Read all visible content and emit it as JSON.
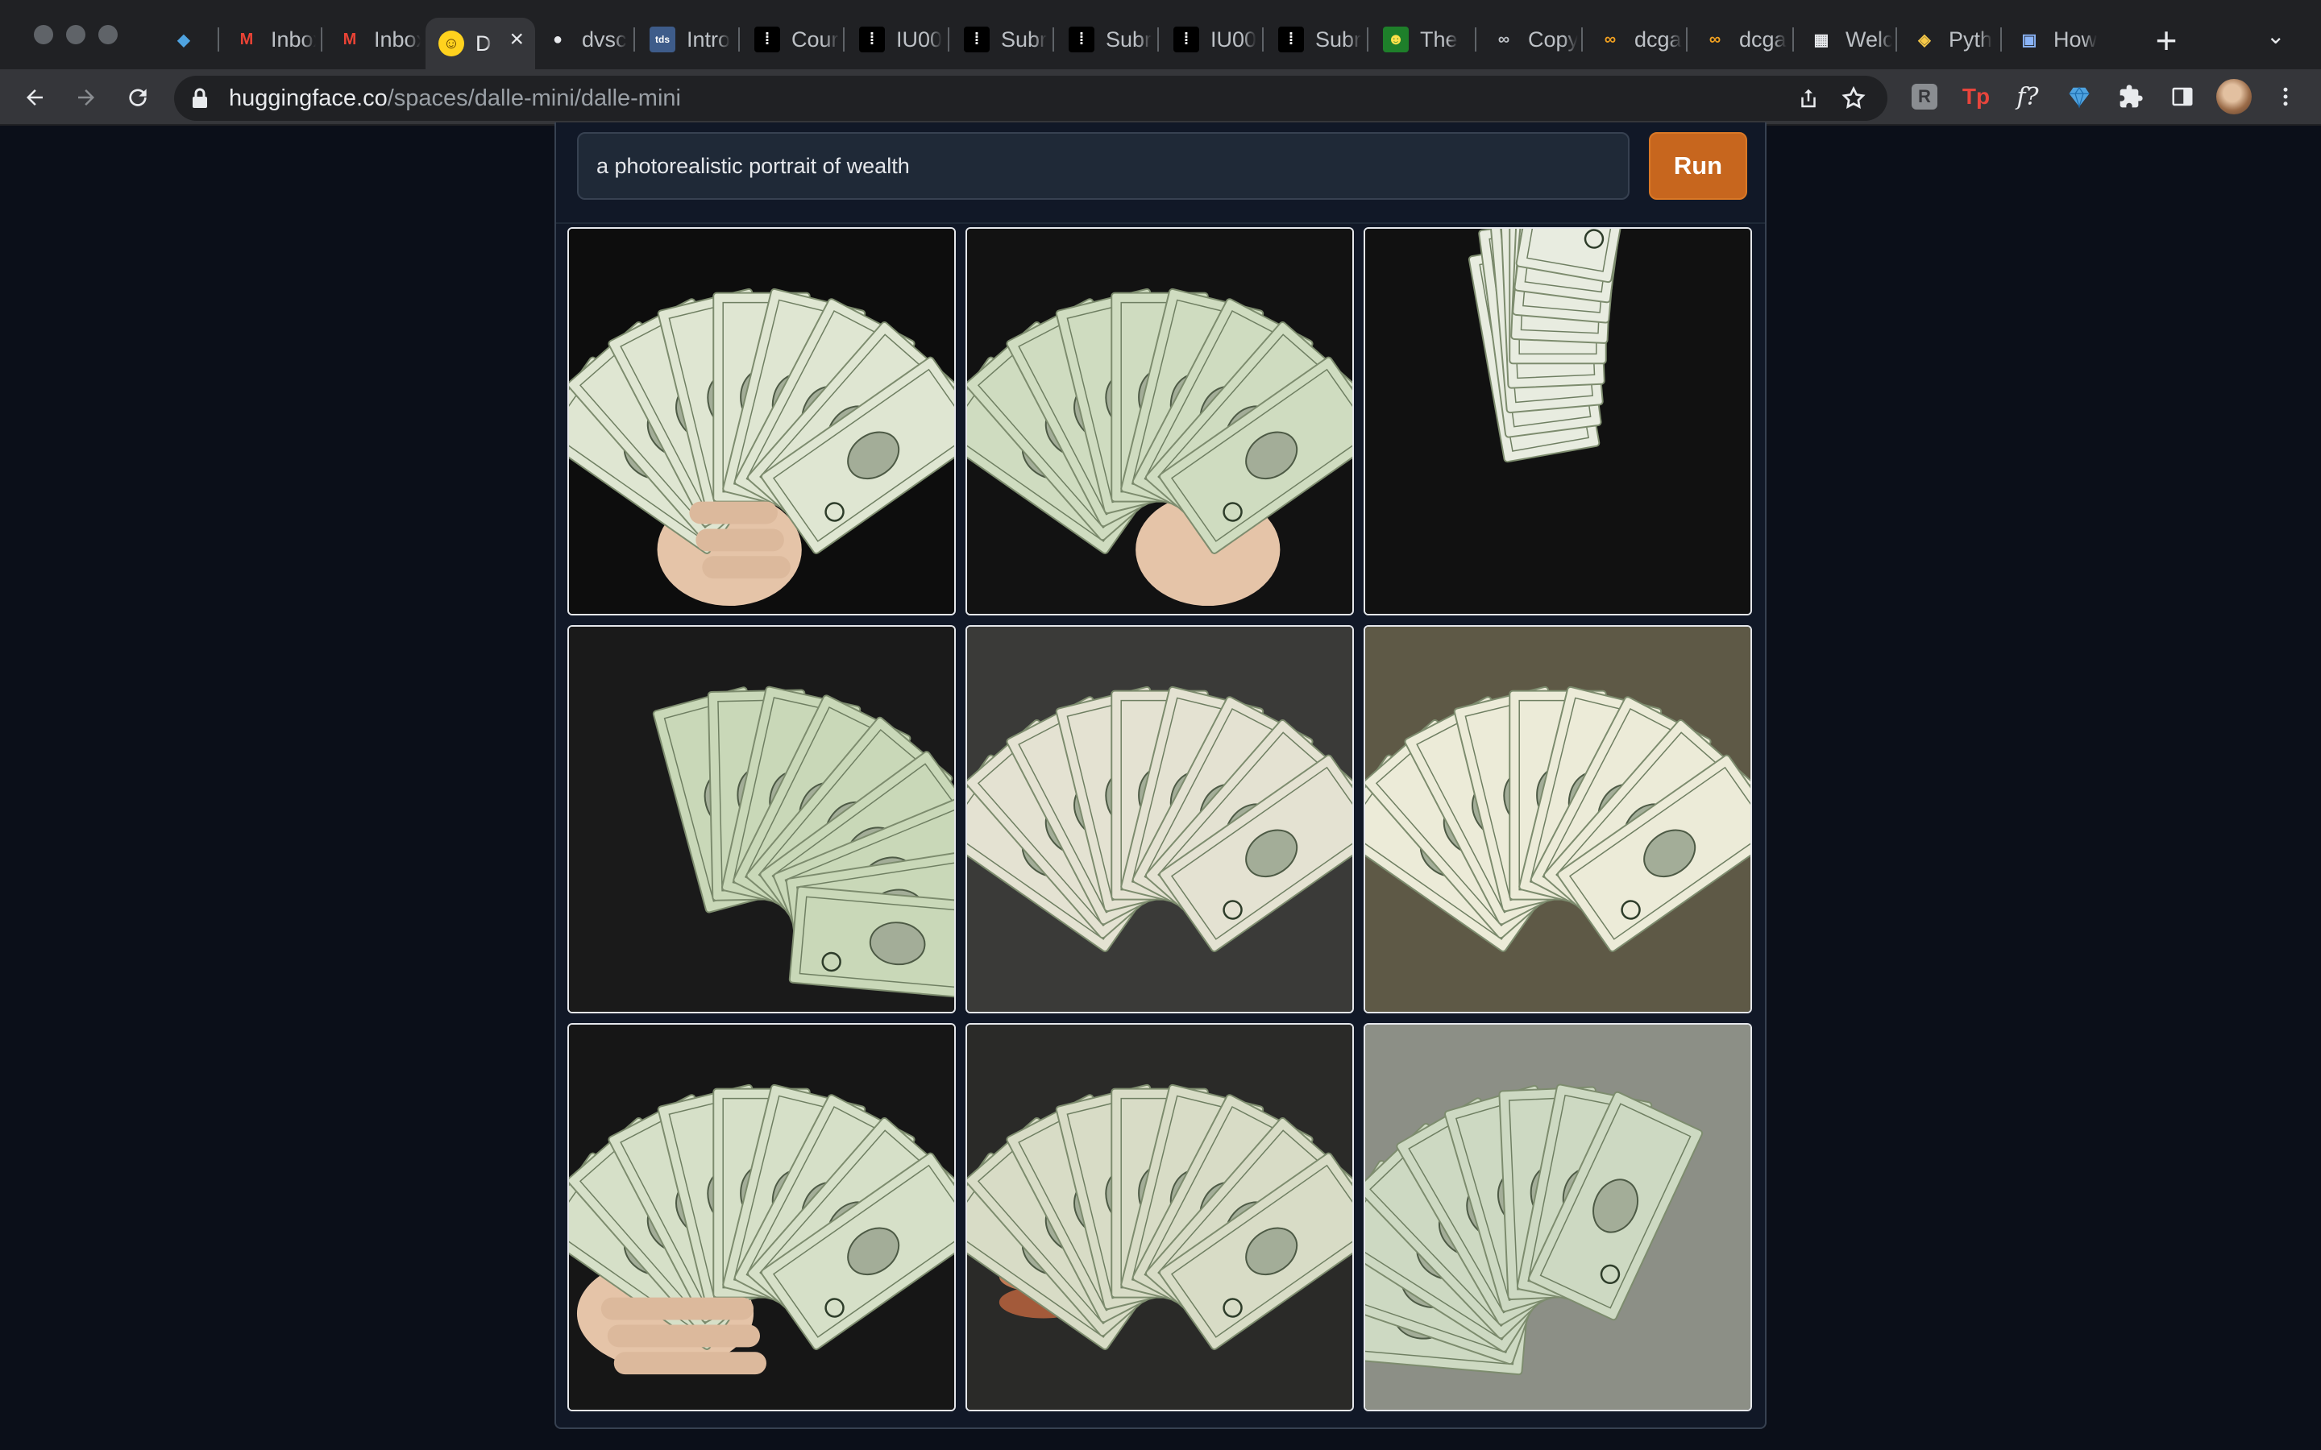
{
  "browser": {
    "tabs": [
      {
        "title": "",
        "icon": "gem-icon",
        "color": "#4fa3e0"
      },
      {
        "title": "Inbox",
        "icon": "gmail-icon",
        "color": "#ea4335"
      },
      {
        "title": "Inbox",
        "icon": "gmail-icon",
        "color": "#ea4335"
      },
      {
        "title": "D",
        "icon": "huggingface-icon",
        "color": "#ffd21e",
        "active": true
      },
      {
        "title": "dvsc",
        "icon": "github-icon",
        "color": "#e8eaed"
      },
      {
        "title": "Intro",
        "icon": "tds-icon",
        "color": "#3e5c8a"
      },
      {
        "title": "Cour",
        "icon": "medium-dots-icon",
        "color": "#e8eaed"
      },
      {
        "title": "IU00",
        "icon": "medium-dots-icon",
        "color": "#e8eaed"
      },
      {
        "title": "Subr",
        "icon": "medium-dots-icon",
        "color": "#e8eaed"
      },
      {
        "title": "Subr",
        "icon": "medium-dots-icon",
        "color": "#e8eaed"
      },
      {
        "title": "IU00",
        "icon": "medium-dots-icon",
        "color": "#e8eaed"
      },
      {
        "title": "Subr",
        "icon": "medium-dots-icon",
        "color": "#e8eaed"
      },
      {
        "title": "The",
        "icon": "smiley-icon",
        "color": "#7ed321"
      },
      {
        "title": "Copy",
        "icon": "infinity-icon",
        "color": "#bdc1c6"
      },
      {
        "title": "dcga",
        "icon": "infinity-icon",
        "color": "#f0a020"
      },
      {
        "title": "dcga",
        "icon": "infinity-icon",
        "color": "#f0a020"
      },
      {
        "title": "Welc",
        "icon": "qr-icon",
        "color": "#e8eaed"
      },
      {
        "title": "Pyth",
        "icon": "python-icon",
        "color": "#f7c948"
      },
      {
        "title": "How",
        "icon": "image-icon",
        "color": "#8ab4f8"
      }
    ],
    "new_tab": "+",
    "tab_menu": "⌄",
    "url_host": "huggingface.co",
    "url_path": "/spaces/dalle-mini/dalle-mini"
  },
  "app": {
    "prompt_value": "a photorealistic portrait  of wealth",
    "run_label": "Run",
    "accent_color": "#c7661e",
    "images": [
      {
        "description": "hand holding fanned dollar bills",
        "bg": "#0d0d0d"
      },
      {
        "description": "hand holding fan of dollar bills",
        "bg": "#121212"
      },
      {
        "description": "stack of twisted dollar bills",
        "bg": "#111111"
      },
      {
        "description": "pile of dollar bills",
        "bg": "#1a1a1a"
      },
      {
        "description": "fan of dollar bills",
        "bg": "#3a3a38"
      },
      {
        "description": "fan of dollar bills on beige",
        "bg": "#5e5946"
      },
      {
        "description": "hand holding dollar bills",
        "bg": "#161616"
      },
      {
        "description": "dollar bills with copper coins",
        "bg": "#2a2a28"
      },
      {
        "description": "wave of dollar bills",
        "bg": "#8c8f86"
      }
    ]
  }
}
